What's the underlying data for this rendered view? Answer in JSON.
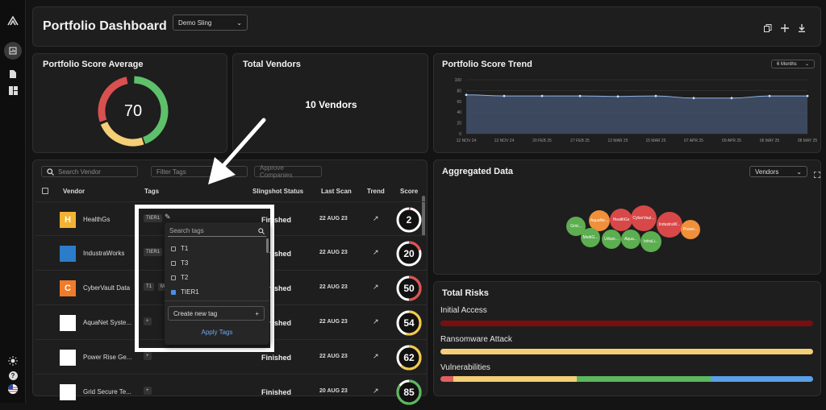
{
  "header": {
    "title": "Portfolio Dashboard",
    "portfolio_select": "Demo Sling"
  },
  "score_avg": {
    "title": "Portfolio Score Average",
    "value": "70"
  },
  "vendors_total": {
    "title": "Total Vendors",
    "value": "10 Vendors"
  },
  "trend": {
    "title": "Portfolio Score Trend",
    "range": "6 Months"
  },
  "chart_data": {
    "type": "area",
    "title": "Portfolio Score Trend",
    "x": [
      "12 NOV 24",
      "13 NOV 24",
      "20 FEB 25",
      "27 FEB 25",
      "12 MAR 25",
      "15 MAR 25",
      "07 APR 25",
      "09 APR 25",
      "06 MAY 25",
      "08 MAY 25"
    ],
    "y": [
      72,
      70,
      70,
      70,
      69,
      70,
      66,
      66,
      70,
      70
    ],
    "ylim": [
      0,
      100
    ],
    "yticks": [
      "100",
      "80",
      "60",
      "40",
      "20",
      "0"
    ]
  },
  "vendors_table": {
    "search_placeholder": "Search Vendor",
    "filter_tags_placeholder": "Filter Tags",
    "approve_button": "Approve Companies",
    "columns": [
      "Vendor",
      "Tags",
      "Slingshot Status",
      "Last Scan",
      "Trend",
      "Score"
    ],
    "rows": [
      {
        "name": "HealthGs",
        "tag": "TIER1",
        "status": "Finished",
        "last_scan": "22 AUG 23",
        "score": "2",
        "logo": "H",
        "logo_color": "#f2b233",
        "score_color": "#e05050",
        "score_frac": 0.02
      },
      {
        "name": "IndustraWorks",
        "tag": "TIER1",
        "status": "Finished",
        "last_scan": "22 AUG 23",
        "score": "20",
        "logo": "",
        "logo_color": "#2b7cc9",
        "score_color": "#e05050",
        "score_frac": 0.2
      },
      {
        "name": "CyberVault Data",
        "tag": "T1",
        "tag2": "M",
        "status": "Finished",
        "last_scan": "22 AUG 23",
        "score": "50",
        "logo": "C",
        "logo_color": "#f07b2a",
        "score_color": "#e05050",
        "score_frac": 0.5
      },
      {
        "name": "AquaNet Syste...",
        "tag": "+",
        "status": "Finished",
        "last_scan": "22 AUG 23",
        "score": "54",
        "logo": "",
        "logo_color": "#ffffff",
        "score_color": "#f2c94c",
        "score_frac": 0.54
      },
      {
        "name": "Power Rise Ge...",
        "tag": "+",
        "status": "Finished",
        "last_scan": "22 AUG 23",
        "score": "62",
        "logo": "",
        "logo_color": "#ffffff",
        "score_color": "#f2c94c",
        "score_frac": 0.62
      },
      {
        "name": "Grid Secure Te...",
        "tag": "+",
        "status": "Finished",
        "last_scan": "20 AUG 23",
        "score": "85",
        "logo": "",
        "logo_color": "#ffffff",
        "score_color": "#5cb85c",
        "score_frac": 0.85
      }
    ]
  },
  "tag_dropdown": {
    "search_placeholder": "Search tags",
    "options": [
      {
        "label": "T1",
        "checked": false
      },
      {
        "label": "T3",
        "checked": false
      },
      {
        "label": "T2",
        "checked": false
      },
      {
        "label": "TIER1",
        "checked": true
      }
    ],
    "create_label": "Create new tag",
    "apply_label": "Apply Tags"
  },
  "aggregated": {
    "title": "Aggregated Data",
    "group_select": "Vendors",
    "bubbles": [
      {
        "label": "Grid...",
        "color": "#5cae50"
      },
      {
        "label": "AquaNe...",
        "color": "#f0903a"
      },
      {
        "label": "HealthGs",
        "color": "#d84848"
      },
      {
        "label": "CyberVaul...",
        "color": "#d84848"
      },
      {
        "label": "IndustraW...",
        "color": "#d84848"
      },
      {
        "label": "Power...",
        "color": "#f0903a"
      },
      {
        "label": "MediG...",
        "color": "#5cae50"
      },
      {
        "label": "Urban...",
        "color": "#5cae50"
      },
      {
        "label": "Aqua...",
        "color": "#5cae50"
      },
      {
        "label": "InfraLi...",
        "color": "#5cae50"
      }
    ]
  },
  "risks": {
    "title": "Total Risks",
    "items": [
      {
        "label": "Initial Access",
        "segments": [
          {
            "color": "#7a0e0e",
            "frac": 1.0
          }
        ]
      },
      {
        "label": "Ransomware Attack",
        "segments": [
          {
            "color": "#f4cf76",
            "frac": 1.0
          }
        ]
      },
      {
        "label": "Vulnerabilities",
        "segments": [
          {
            "color": "#e06060",
            "frac": 0.035
          },
          {
            "color": "#f4cf76",
            "frac": 0.33
          },
          {
            "color": "#5cb85c",
            "frac": 0.36
          },
          {
            "color": "#5aa0e8",
            "frac": 0.275
          }
        ]
      }
    ]
  }
}
